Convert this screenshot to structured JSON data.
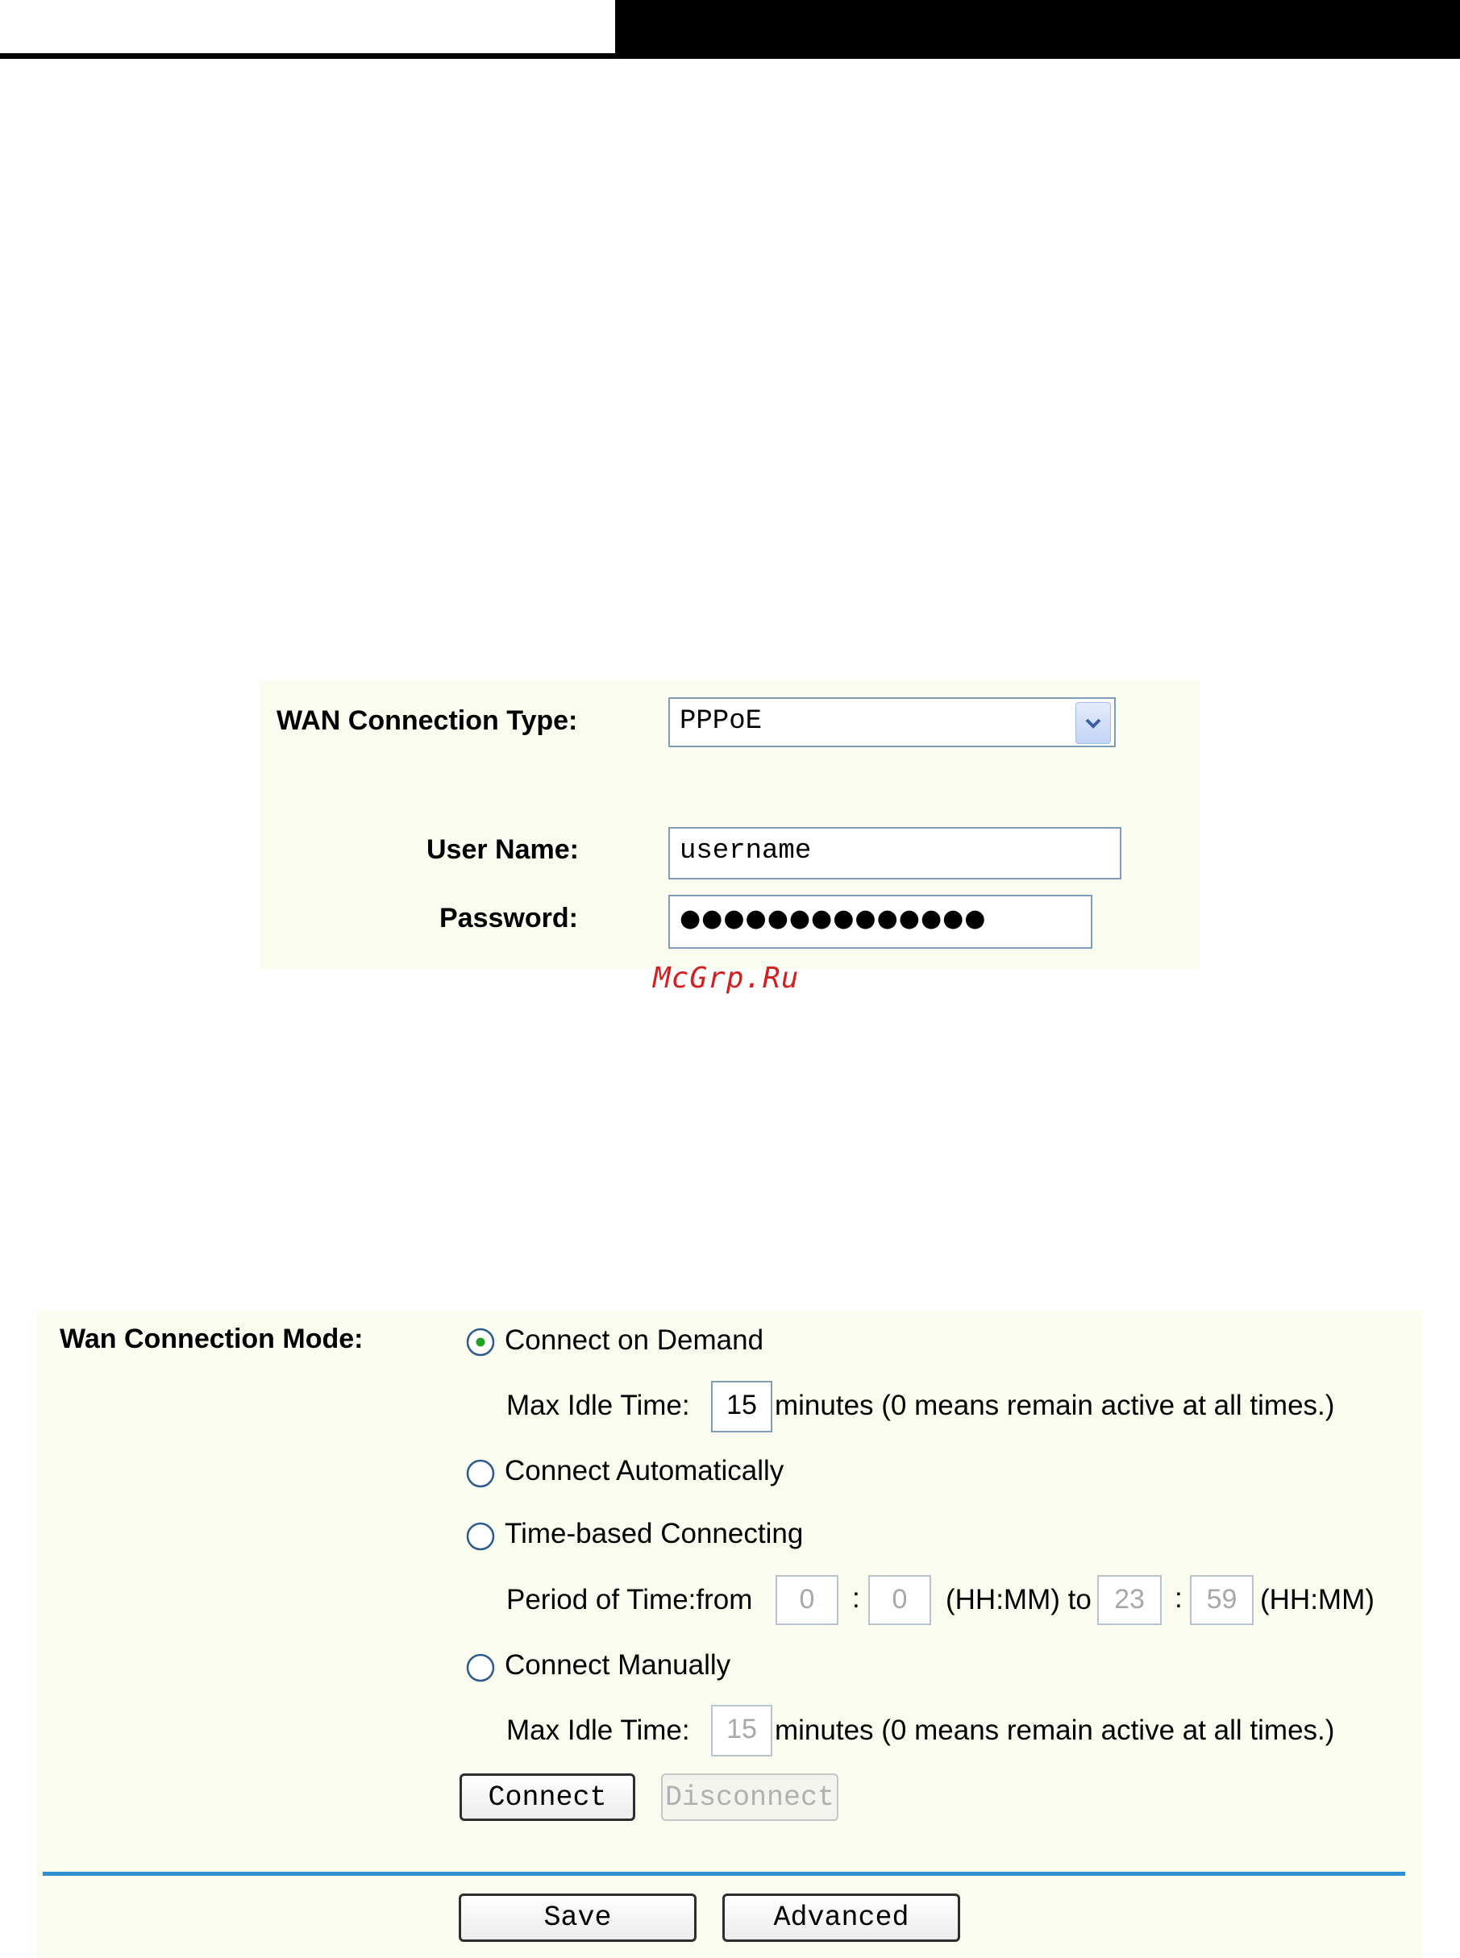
{
  "watermark": "McGrp.Ru",
  "wan_form": {
    "connection_type_label": "WAN Connection Type:",
    "connection_type_value": "PPPoE",
    "username_label": "User Name:",
    "username_value": "username",
    "password_label": "Password:",
    "password_value": "●●●●●●●●●●●●●●"
  },
  "mode_form": {
    "mode_label": "Wan Connection Mode:",
    "options": {
      "on_demand": "Connect on Demand",
      "automatically": "Connect Automatically",
      "time_based": "Time-based Connecting",
      "manually": "Connect Manually"
    },
    "selected_option": "on_demand",
    "max_idle_label": "Max Idle Time:",
    "max_idle_value": "15",
    "minutes_note": "minutes (0 means remain active at all times.)",
    "period_label": "Period of Time:from",
    "period_from_hh": "0",
    "period_from_mm": "0",
    "hhmm_to": "(HH:MM) to",
    "period_to_hh": "23",
    "period_to_mm": "59",
    "hhmm": "(HH:MM)",
    "colon": ":",
    "manual_idle_value": "15",
    "connect_button": "Connect",
    "disconnect_button": "Disconnect",
    "save_button": "Save",
    "advanced_button": "Advanced"
  },
  "colors": {
    "panel_bg": "#fbfcf0",
    "field_border": "#7f9db9",
    "divider": "#2f8fd0",
    "radio_selected_dot": "#21a121",
    "watermark": "#d41f1f"
  }
}
